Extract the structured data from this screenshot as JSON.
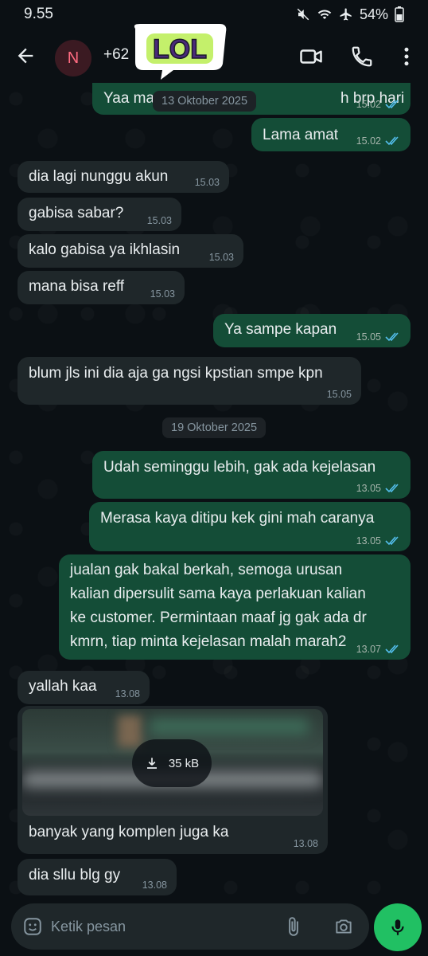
{
  "status": {
    "time": "9.55",
    "battery": "54%"
  },
  "header": {
    "avatar_letter": "N",
    "contact": "+62"
  },
  "sticker": {
    "text": "LOL"
  },
  "dates": [
    "13 Oktober 2025",
    "19 Oktober 2025"
  ],
  "messages": [
    {
      "dir": "out",
      "text": "Yaa ma",
      "text_tail": "h brp hari",
      "time": "15.02",
      "read": true
    },
    {
      "dir": "out",
      "text": "Lama amat",
      "time": "15.02",
      "read": true
    },
    {
      "dir": "in",
      "text": "dia lagi nunggu akun",
      "time": "15.03"
    },
    {
      "dir": "in",
      "text": "gabisa sabar?",
      "time": "15.03"
    },
    {
      "dir": "in",
      "text": "kalo gabisa ya ikhlasin",
      "time": "15.03"
    },
    {
      "dir": "in",
      "text": "mana bisa reff",
      "time": "15.03"
    },
    {
      "dir": "out",
      "text": "Ya sampe kapan",
      "time": "15.05",
      "read": true
    },
    {
      "dir": "in",
      "text": "blum jls ini dia aja ga ngsi kpstian smpe kpn",
      "time": "15.05"
    },
    {
      "dir": "out",
      "text": "Udah seminggu lebih, gak ada kejelasan",
      "time": "13.05",
      "read": true
    },
    {
      "dir": "out",
      "text": "Merasa kaya ditipu kek gini mah caranya",
      "time": "13.05",
      "read": true
    },
    {
      "dir": "out",
      "text": "jualan gak bakal berkah, semoga urusan\nkalian dipersulit sama kaya perlakuan kalian\nke customer. Permintaan maaf jg gak ada dr\nkmrn, tiap minta kejelasan malah marah2",
      "time": "13.07",
      "read": true
    },
    {
      "dir": "in",
      "text": "yallah kaa",
      "time": "13.08"
    },
    {
      "dir": "in",
      "text": "banyak yang komplen juga ka",
      "time": "13.08",
      "media_size": "35 kB"
    },
    {
      "dir": "in",
      "text": "dia sllu blg gy",
      "time": "13.08"
    }
  ],
  "composer": {
    "placeholder": "Ketik pesan"
  },
  "colors": {
    "outgoing": "#144d37",
    "incoming": "#1f272a",
    "accent": "#21c063",
    "tick": "#53bdeb"
  },
  "icons": [
    "back-arrow-icon",
    "video-call-icon",
    "phone-icon",
    "more-vert-icon",
    "emoji-icon",
    "attach-icon",
    "camera-icon",
    "mic-icon",
    "download-icon",
    "read-tick-icon"
  ]
}
